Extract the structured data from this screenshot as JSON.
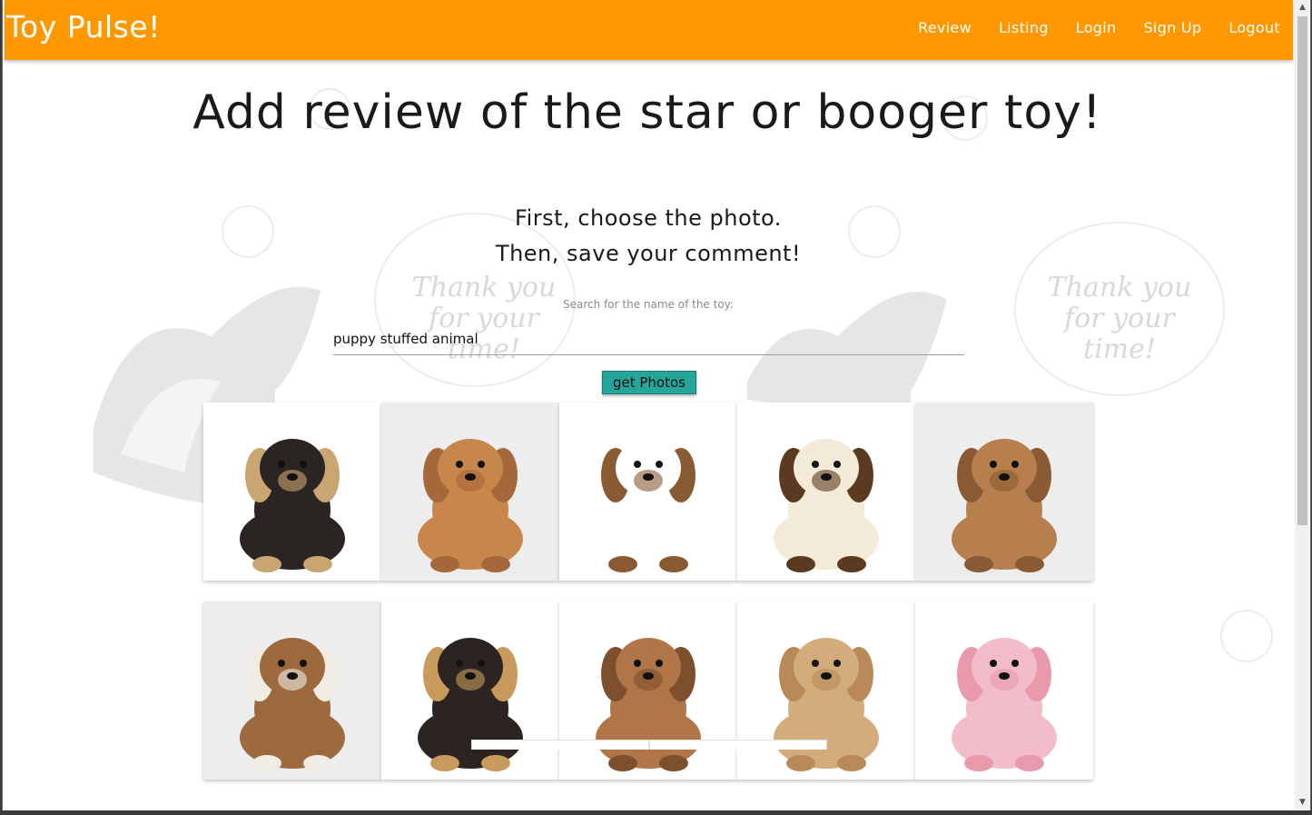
{
  "navbar": {
    "brand": "Toy Pulse!",
    "links": [
      "Review",
      "Listing",
      "Login",
      "Sign Up",
      "Logout"
    ]
  },
  "page": {
    "title": "Add review of the star or booger toy!",
    "subtitle_1": "First, choose the photo.",
    "subtitle_2": "Then, save your comment!",
    "search_label": "Search for the name of the toy:",
    "search_value": "puppy stuffed animal",
    "button_label": "get Photos"
  },
  "background": {
    "bubble_text": "Thank you for your time!"
  },
  "photos": [
    {
      "alt": "german shepherd puppy plush",
      "colors": [
        "#2a2522",
        "#c9a572"
      ]
    },
    {
      "alt": "cocker spaniel plush",
      "colors": [
        "#c7864c",
        "#a5683a"
      ]
    },
    {
      "alt": "beagle plush",
      "colors": [
        "#ffffff",
        "#8a5a33"
      ]
    },
    {
      "alt": "panda-faced puppy plush",
      "colors": [
        "#f3ead8",
        "#5a3b22"
      ]
    },
    {
      "alt": "bulldog plush",
      "colors": [
        "#b67f4d",
        "#8a5a34"
      ]
    },
    {
      "alt": "basset hound plush",
      "colors": [
        "#9c6a3d",
        "#f0ece4"
      ]
    },
    {
      "alt": "lying german shepherd plush",
      "colors": [
        "#2b2420",
        "#c89b5c"
      ]
    },
    {
      "alt": "brown puppy plush",
      "colors": [
        "#b07648",
        "#7d4f2c"
      ]
    },
    {
      "alt": "curly tan puppy plush",
      "colors": [
        "#d3ac7c",
        "#b88a58"
      ]
    },
    {
      "alt": "pink puppy plush",
      "colors": [
        "#f2bcc8",
        "#e89aac"
      ]
    }
  ]
}
